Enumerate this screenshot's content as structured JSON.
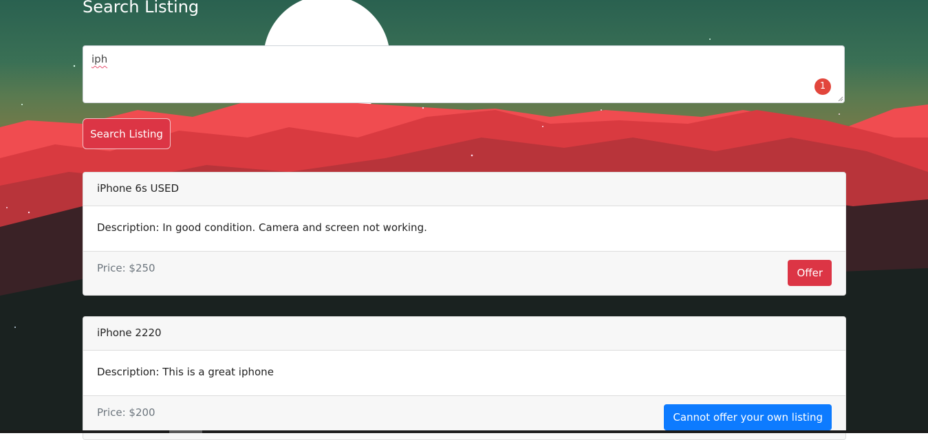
{
  "page": {
    "title": "Search Listing"
  },
  "search": {
    "value": "iph",
    "error_count": "1",
    "button_label": "Search Listing"
  },
  "listings": [
    {
      "title": "iPhone 6s USED",
      "description": "Description: In good condition. Camera and screen not working.",
      "price": "Price: $250",
      "action_label": "Offer"
    },
    {
      "title": "iPhone 2220",
      "description": "Description: This is a great iphone",
      "price": "Price: $200",
      "action_label": "Cannot offer your own listing"
    }
  ],
  "colors": {
    "danger": "#dc3545",
    "primary": "#0d7bff",
    "sky": "#2a6150",
    "mountains": "#e0434a"
  }
}
